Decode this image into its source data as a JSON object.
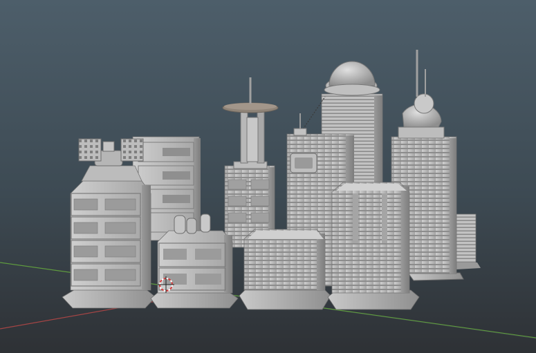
{
  "viewport": {
    "kind": "3d-viewport",
    "background_top": "#4d5e6a",
    "background_bottom": "#2e3135"
  },
  "grid": {
    "x_axis_color": "#a54545",
    "y_axis_color": "#5f9c3e"
  },
  "model": {
    "material_color": "#b8b8b8",
    "icons": [
      "3d-cursor-icon"
    ]
  }
}
